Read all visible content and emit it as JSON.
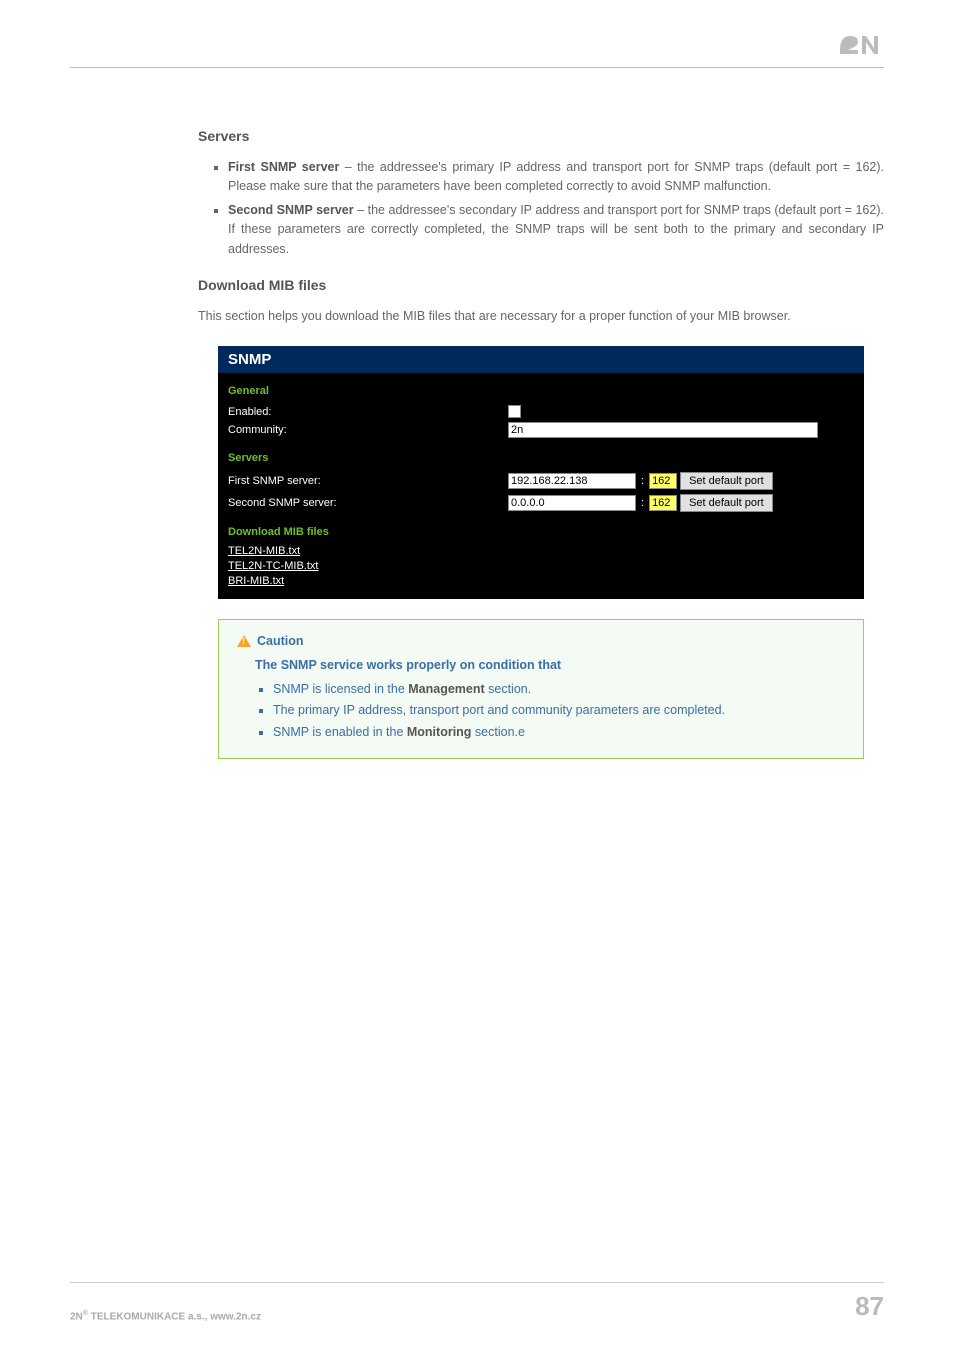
{
  "logo_alt": "2N",
  "sections": {
    "servers_heading": "Servers",
    "servers_items": [
      {
        "label": "First SNMP server",
        "text": " – the addressee's primary IP address and transport port for SNMP traps (default port = 162). Please make sure that the parameters have been completed correctly to avoid SNMP malfunction."
      },
      {
        "label": "Second SNMP server",
        "text": " – the addressee's secondary IP address and transport port for SNMP traps (default port = 162). If these parameters are correctly completed, the SNMP traps will be sent both to the primary and secondary IP addresses."
      }
    ],
    "download_heading": "Download MIB files",
    "download_desc": "This section helps you download the MIB files that are necessary for a proper function of your MIB browser."
  },
  "snmp": {
    "title": "SNMP",
    "general_heading": "General",
    "enabled_label": "Enabled:",
    "community_label": "Community:",
    "community_value": "2n",
    "servers_heading": "Servers",
    "first_label": "First SNMP server:",
    "second_label": "Second SNMP server:",
    "first_ip": "192.168.22.138",
    "first_port": "162",
    "second_ip": "0.0.0.0",
    "second_port": "162",
    "set_default_port": "Set default port",
    "download_heading": "Download MIB files",
    "files": [
      "TEL2N-MIB.txt",
      "TEL2N-TC-MIB.txt",
      "BRI-MIB.txt"
    ]
  },
  "caution": {
    "title": "Caution",
    "subtitle": "The SNMP service works properly on condition that",
    "items_pre": [
      "SNMP is licensed in the ",
      "The primary IP address, transport port and community parameters are completed.",
      "SNMP is enabled in the "
    ],
    "items_bold": [
      "Management",
      "",
      "Monitoring"
    ],
    "items_post": [
      " section.",
      "",
      " section.e"
    ]
  },
  "footer": {
    "left_pre": "2N",
    "left_sup": "®",
    "left_post": " TELEKOMUNIKACE a.s., www.2n.cz",
    "page": "87"
  }
}
